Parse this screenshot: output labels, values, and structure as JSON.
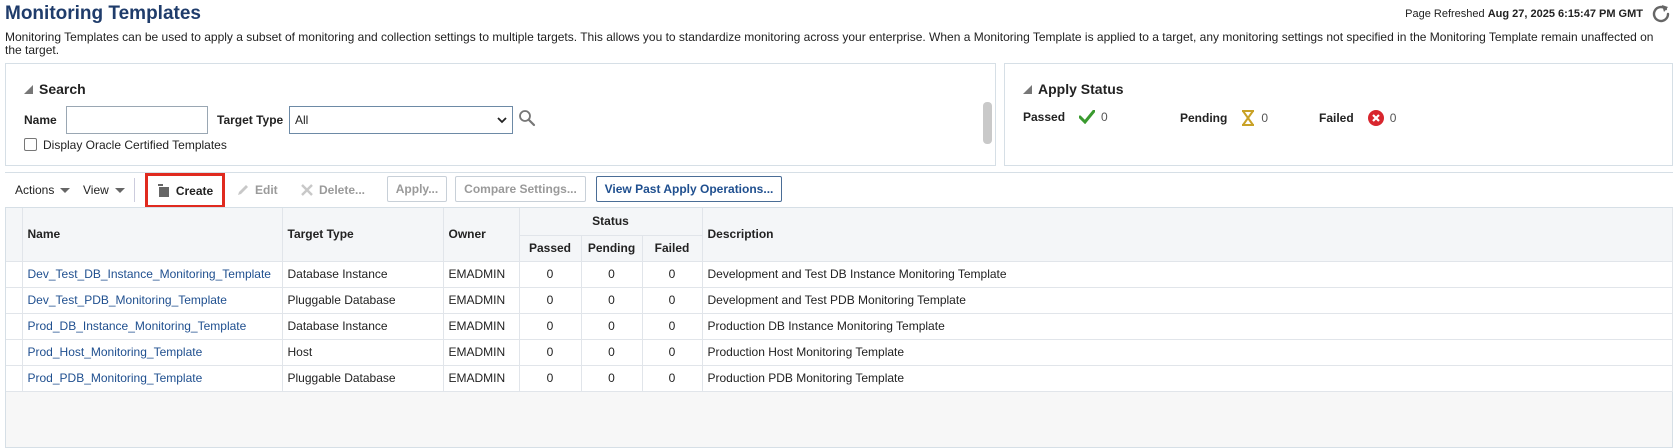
{
  "header": {
    "title": "Monitoring Templates",
    "refreshed_label": "Page Refreshed",
    "refreshed_value": "Aug 27, 2025 6:15:47 PM GMT",
    "intro": "Monitoring Templates can be used to apply a subset of monitoring and collection settings to multiple targets. This allows you to standardize monitoring across your enterprise. When a Monitoring Template is applied to a target, any monitoring settings not specified in the Monitoring Template remain unaffected on the target."
  },
  "search": {
    "title": "Search",
    "name_label": "Name",
    "name_value": "",
    "target_type_label": "Target Type",
    "target_type_value": "All",
    "certified_label": "Display Oracle Certified Templates",
    "certified_checked": false
  },
  "apply_status": {
    "title": "Apply Status",
    "passed_label": "Passed",
    "passed_count": "0",
    "pending_label": "Pending",
    "pending_count": "0",
    "failed_label": "Failed",
    "failed_count": "0"
  },
  "toolbar": {
    "actions": "Actions",
    "view": "View",
    "create": "Create",
    "edit": "Edit",
    "delete": "Delete...",
    "apply": "Apply...",
    "compare": "Compare Settings...",
    "view_past": "View Past Apply Operations..."
  },
  "table": {
    "headers": {
      "name": "Name",
      "target_type": "Target Type",
      "owner": "Owner",
      "status": "Status",
      "passed": "Passed",
      "pending": "Pending",
      "failed": "Failed",
      "description": "Description"
    },
    "rows": [
      {
        "name": "Dev_Test_DB_Instance_Monitoring_Template",
        "target_type": "Database Instance",
        "owner": "EMADMIN",
        "passed": "0",
        "pending": "0",
        "failed": "0",
        "description": "Development and Test DB Instance Monitoring Template"
      },
      {
        "name": "Dev_Test_PDB_Monitoring_Template",
        "target_type": "Pluggable Database",
        "owner": "EMADMIN",
        "passed": "0",
        "pending": "0",
        "failed": "0",
        "description": "Development and Test PDB Monitoring Template"
      },
      {
        "name": "Prod_DB_Instance_Monitoring_Template",
        "target_type": "Database Instance",
        "owner": "EMADMIN",
        "passed": "0",
        "pending": "0",
        "failed": "0",
        "description": "Production DB Instance Monitoring Template"
      },
      {
        "name": "Prod_Host_Monitoring_Template",
        "target_type": "Host",
        "owner": "EMADMIN",
        "passed": "0",
        "pending": "0",
        "failed": "0",
        "description": "Production Host Monitoring Template"
      },
      {
        "name": "Prod_PDB_Monitoring_Template",
        "target_type": "Pluggable Database",
        "owner": "EMADMIN",
        "passed": "0",
        "pending": "0",
        "failed": "0",
        "description": "Production PDB Monitoring Template"
      }
    ]
  },
  "colors": {
    "title": "#1f3c6b",
    "link": "#1f4f8f",
    "highlight": "#e02a1f",
    "passed": "#3a9a2f",
    "pending": "#c9a227",
    "failed": "#d8262e"
  },
  "icons": {
    "refresh": "refresh-icon",
    "search": "search-icon",
    "passed": "checkmark-icon",
    "pending": "hourglass-icon",
    "failed": "error-x-icon",
    "create": "create-icon",
    "edit": "pencil-icon",
    "delete": "delete-x-icon"
  }
}
